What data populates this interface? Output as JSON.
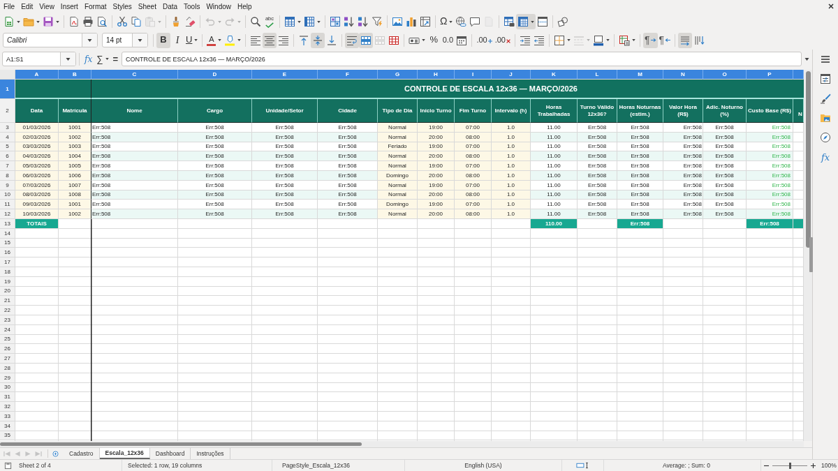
{
  "menu_bar": [
    "File",
    "Edit",
    "View",
    "Insert",
    "Format",
    "Styles",
    "Sheet",
    "Data",
    "Tools",
    "Window",
    "Help"
  ],
  "standard_toolbar": {
    "groups": [
      [
        {
          "kind": "new",
          "dropdown": true,
          "on": false,
          "disabled": false
        },
        {
          "kind": "open",
          "dropdown": true,
          "on": false,
          "disabled": false
        },
        {
          "kind": "save",
          "dropdown": true,
          "on": false,
          "disabled": false
        }
      ],
      [
        {
          "kind": "export-pdf",
          "dropdown": false,
          "on": false,
          "disabled": false
        },
        {
          "kind": "print",
          "dropdown": false,
          "on": false,
          "disabled": false
        },
        {
          "kind": "print-preview",
          "dropdown": false,
          "on": false,
          "disabled": false
        }
      ],
      [
        {
          "kind": "cut",
          "dropdown": false,
          "on": false,
          "disabled": false
        },
        {
          "kind": "copy",
          "dropdown": false,
          "on": false,
          "disabled": false
        },
        {
          "kind": "paste",
          "dropdown": true,
          "on": false,
          "disabled": true
        }
      ],
      [
        {
          "kind": "clone-formatting",
          "dropdown": false,
          "on": false,
          "disabled": false
        },
        {
          "kind": "clear-formatting",
          "dropdown": false,
          "on": false,
          "disabled": false
        }
      ],
      [
        {
          "kind": "undo",
          "dropdown": true,
          "on": false,
          "disabled": true
        },
        {
          "kind": "redo",
          "dropdown": true,
          "on": false,
          "disabled": true
        }
      ],
      [
        {
          "kind": "find-replace",
          "dropdown": false,
          "on": false,
          "disabled": false
        },
        {
          "kind": "spelling",
          "glyph": "abc",
          "dropdown": false,
          "on": false,
          "disabled": false
        }
      ],
      [
        {
          "kind": "rows",
          "dropdown": true,
          "on": false,
          "disabled": false
        },
        {
          "kind": "columns",
          "dropdown": true,
          "on": false,
          "disabled": false
        }
      ],
      [
        {
          "kind": "sort",
          "dropdown": false,
          "on": false,
          "disabled": false
        },
        {
          "kind": "sort-ascending",
          "dropdown": false,
          "on": false,
          "disabled": false
        },
        {
          "kind": "sort-descending",
          "dropdown": false,
          "on": false,
          "disabled": false
        },
        {
          "kind": "autofilter",
          "dropdown": false,
          "on": false,
          "disabled": false
        }
      ],
      [
        {
          "kind": "image",
          "dropdown": false,
          "on": false,
          "disabled": false
        },
        {
          "kind": "chart",
          "dropdown": false,
          "on": false,
          "disabled": false
        },
        {
          "kind": "pivot-table",
          "dropdown": false,
          "on": false,
          "disabled": false
        }
      ],
      [
        {
          "kind": "special-character",
          "glyph": "Ω",
          "dropdown": true,
          "on": false,
          "disabled": false
        },
        {
          "kind": "hyperlink",
          "dropdown": false,
          "on": false,
          "disabled": false
        },
        {
          "kind": "comment",
          "dropdown": false,
          "on": false,
          "disabled": false
        },
        {
          "kind": "header-footer",
          "dropdown": false,
          "on": false,
          "disabled": true
        }
      ],
      [
        {
          "kind": "print-area",
          "dropdown": false,
          "on": false,
          "disabled": false
        },
        {
          "kind": "freeze",
          "dropdown": true,
          "on": true,
          "disabled": false
        },
        {
          "kind": "split-window",
          "dropdown": false,
          "on": false,
          "disabled": false
        }
      ],
      [
        {
          "kind": "draw-functions",
          "dropdown": false,
          "on": false,
          "disabled": false
        }
      ]
    ]
  },
  "formatting_toolbar": {
    "font_name": "Calibri",
    "font_size": "14 pt",
    "groups": [
      [
        {
          "kind": "bold",
          "glyph": "B",
          "dropdown": false,
          "on": true,
          "disabled": false
        },
        {
          "kind": "italic",
          "glyph": "I",
          "dropdown": false,
          "on": false,
          "disabled": false
        },
        {
          "kind": "underline",
          "glyph": "U",
          "dropdown": true,
          "on": false,
          "disabled": false
        }
      ],
      [
        {
          "kind": "font-color",
          "glyph": "A",
          "dropdown": true,
          "on": false,
          "disabled": false
        },
        {
          "kind": "highlight",
          "dropdown": true,
          "on": false,
          "disabled": false
        }
      ],
      [
        {
          "kind": "align-left",
          "dropdown": false,
          "on": false,
          "disabled": false
        },
        {
          "kind": "align-center",
          "dropdown": false,
          "on": true,
          "disabled": false
        },
        {
          "kind": "align-right",
          "dropdown": false,
          "on": false,
          "disabled": false
        }
      ],
      [
        {
          "kind": "align-top",
          "dropdown": false,
          "on": false,
          "disabled": false
        },
        {
          "kind": "center-vertically",
          "dropdown": false,
          "on": true,
          "disabled": false
        },
        {
          "kind": "align-bottom",
          "dropdown": false,
          "on": false,
          "disabled": false
        }
      ],
      [
        {
          "kind": "wrap",
          "dropdown": false,
          "on": true,
          "disabled": false
        },
        {
          "kind": "merge-center",
          "dropdown": false,
          "on": true,
          "disabled": false
        },
        {
          "kind": "merge",
          "dropdown": false,
          "on": false,
          "disabled": true
        },
        {
          "kind": "unmerge",
          "dropdown": false,
          "on": false,
          "disabled": false
        }
      ],
      [
        {
          "kind": "number-format",
          "dropdown": true,
          "on": false,
          "disabled": false
        },
        {
          "kind": "percent",
          "glyph": "%",
          "dropdown": false,
          "on": false,
          "disabled": false
        },
        {
          "kind": "standard",
          "glyph": "0.0",
          "dropdown": false,
          "on": false,
          "disabled": false
        },
        {
          "kind": "date",
          "dropdown": false,
          "on": false,
          "disabled": false
        }
      ],
      [
        {
          "kind": "add-decimal",
          "glyph": ".00",
          "dropdown": false,
          "on": false,
          "disabled": false
        },
        {
          "kind": "delete-decimal",
          "glyph": ".00",
          "dropdown": false,
          "on": false,
          "disabled": false
        }
      ],
      [
        {
          "kind": "increase-indent",
          "dropdown": false,
          "on": false,
          "disabled": false
        },
        {
          "kind": "decrease-indent",
          "dropdown": false,
          "on": false,
          "disabled": false
        }
      ],
      [
        {
          "kind": "borders",
          "dropdown": true,
          "on": false,
          "disabled": false
        },
        {
          "kind": "border-style",
          "dropdown": true,
          "on": false,
          "disabled": true
        },
        {
          "kind": "border-color",
          "dropdown": true,
          "on": false,
          "disabled": false
        }
      ],
      [
        {
          "kind": "conditional",
          "dropdown": true,
          "on": false,
          "disabled": false
        }
      ],
      [
        {
          "kind": "left-to-right",
          "glyph": "¶",
          "dropdown": false,
          "on": true,
          "disabled": false
        },
        {
          "kind": "right-to-left",
          "glyph": "¶",
          "dropdown": false,
          "on": false,
          "disabled": false
        }
      ],
      [
        {
          "kind": "text-horizontal",
          "dropdown": false,
          "on": true,
          "disabled": false
        },
        {
          "kind": "text-vertical",
          "dropdown": false,
          "on": false,
          "disabled": false
        }
      ]
    ]
  },
  "formula_bar": {
    "name_box": "A1:S1",
    "function_wizard": "fx",
    "sum": "∑",
    "equals": "=",
    "content": "CONTROLE DE ESCALA 12x36 — MARÇO/2026"
  },
  "sidebar": {
    "functions": "fx"
  },
  "sheet": {
    "title": "CONTROLE DE ESCALA 12x36 — MARÇO/2026",
    "columns": [
      {
        "letter": "A",
        "selected": true,
        "header": "Data",
        "kind": "input",
        "total": "TOTAIS"
      },
      {
        "letter": "B",
        "selected": true,
        "header": "Matrícula",
        "kind": "input"
      },
      {
        "letter": "C",
        "selected": true,
        "header": "Nome",
        "kind": "text"
      },
      {
        "letter": "D",
        "selected": true,
        "header": "Cargo",
        "kind": "calc"
      },
      {
        "letter": "E",
        "selected": true,
        "header": "Unidade/Setor",
        "kind": "calc"
      },
      {
        "letter": "F",
        "selected": true,
        "header": "Cidade",
        "kind": "calc"
      },
      {
        "letter": "G",
        "selected": true,
        "header": "Tipo de Dia",
        "kind": "input"
      },
      {
        "letter": "H",
        "selected": true,
        "header": "Início Turno",
        "kind": "input"
      },
      {
        "letter": "I",
        "selected": true,
        "header": "Fim Turno",
        "kind": "input"
      },
      {
        "letter": "J",
        "selected": true,
        "header": "Intervalo (h)",
        "kind": "input"
      },
      {
        "letter": "K",
        "selected": true,
        "header": "Horas Trabalhadas",
        "kind": "calc",
        "total": "110.00"
      },
      {
        "letter": "L",
        "selected": true,
        "header": "Turno Válido 12x36?",
        "kind": "calc"
      },
      {
        "letter": "M",
        "selected": true,
        "header": "Horas Noturnas (estim.)",
        "kind": "calc",
        "total": "Err:508"
      },
      {
        "letter": "N",
        "selected": true,
        "header": "Valor Hora (R$)",
        "kind": "amount"
      },
      {
        "letter": "O",
        "selected": true,
        "header": "Adic. Noturno (%)",
        "kind": "calc"
      },
      {
        "letter": "P",
        "selected": true,
        "header": "Custo Base (R$)",
        "kind": "result",
        "total": "Err:508"
      }
    ],
    "cut_column": {
      "selected": true,
      "header": "N",
      "total_filled": true
    },
    "rows": [
      [
        "01/03/2026",
        "1001",
        "Err:508",
        "Err:508",
        "Err:508",
        "Err:508",
        "Normal",
        "19:00",
        "07:00",
        "1.0",
        "11.00",
        "Err:508",
        "Err:508",
        "Err:508",
        "Err:508",
        "Err:508"
      ],
      [
        "02/03/2026",
        "1002",
        "Err:508",
        "Err:508",
        "Err:508",
        "Err:508",
        "Normal",
        "20:00",
        "08:00",
        "1.0",
        "11.00",
        "Err:508",
        "Err:508",
        "Err:508",
        "Err:508",
        "Err:508"
      ],
      [
        "03/03/2026",
        "1003",
        "Err:508",
        "Err:508",
        "Err:508",
        "Err:508",
        "Feriado",
        "19:00",
        "07:00",
        "1.0",
        "11.00",
        "Err:508",
        "Err:508",
        "Err:508",
        "Err:508",
        "Err:508"
      ],
      [
        "04/03/2026",
        "1004",
        "Err:508",
        "Err:508",
        "Err:508",
        "Err:508",
        "Normal",
        "20:00",
        "08:00",
        "1.0",
        "11.00",
        "Err:508",
        "Err:508",
        "Err:508",
        "Err:508",
        "Err:508"
      ],
      [
        "05/03/2026",
        "1005",
        "Err:508",
        "Err:508",
        "Err:508",
        "Err:508",
        "Normal",
        "19:00",
        "07:00",
        "1.0",
        "11.00",
        "Err:508",
        "Err:508",
        "Err:508",
        "Err:508",
        "Err:508"
      ],
      [
        "06/03/2026",
        "1006",
        "Err:508",
        "Err:508",
        "Err:508",
        "Err:508",
        "Domingo",
        "20:00",
        "08:00",
        "1.0",
        "11.00",
        "Err:508",
        "Err:508",
        "Err:508",
        "Err:508",
        "Err:508"
      ],
      [
        "07/03/2026",
        "1007",
        "Err:508",
        "Err:508",
        "Err:508",
        "Err:508",
        "Normal",
        "19:00",
        "07:00",
        "1.0",
        "11.00",
        "Err:508",
        "Err:508",
        "Err:508",
        "Err:508",
        "Err:508"
      ],
      [
        "08/03/2026",
        "1008",
        "Err:508",
        "Err:508",
        "Err:508",
        "Err:508",
        "Normal",
        "20:00",
        "08:00",
        "1.0",
        "11.00",
        "Err:508",
        "Err:508",
        "Err:508",
        "Err:508",
        "Err:508"
      ],
      [
        "09/03/2026",
        "1001",
        "Err:508",
        "Err:508",
        "Err:508",
        "Err:508",
        "Domingo",
        "19:00",
        "07:00",
        "1.0",
        "11.00",
        "Err:508",
        "Err:508",
        "Err:508",
        "Err:508",
        "Err:508"
      ],
      [
        "10/03/2026",
        "1002",
        "Err:508",
        "Err:508",
        "Err:508",
        "Err:508",
        "Normal",
        "20:00",
        "08:00",
        "1.0",
        "11.00",
        "Err:508",
        "Err:508",
        "Err:508",
        "Err:508",
        "Err:508"
      ]
    ],
    "row_numbers": [
      {
        "label": "1",
        "selected": true
      },
      {
        "label": "2",
        "selected": false
      },
      {
        "label": "3",
        "selected": false
      },
      {
        "label": "4",
        "selected": false
      },
      {
        "label": "5",
        "selected": false
      },
      {
        "label": "6",
        "selected": false
      },
      {
        "label": "7",
        "selected": false
      },
      {
        "label": "8",
        "selected": false
      },
      {
        "label": "9",
        "selected": false
      },
      {
        "label": "10",
        "selected": false
      },
      {
        "label": "11",
        "selected": false
      },
      {
        "label": "12",
        "selected": false
      },
      {
        "label": "13",
        "selected": false
      },
      {
        "label": "14",
        "selected": false
      },
      {
        "label": "15",
        "selected": false
      },
      {
        "label": "16",
        "selected": false
      },
      {
        "label": "17",
        "selected": false
      },
      {
        "label": "18",
        "selected": false
      },
      {
        "label": "19",
        "selected": false
      },
      {
        "label": "20",
        "selected": false
      },
      {
        "label": "21",
        "selected": false
      },
      {
        "label": "22",
        "selected": false
      },
      {
        "label": "23",
        "selected": false
      },
      {
        "label": "24",
        "selected": false
      },
      {
        "label": "25",
        "selected": false
      },
      {
        "label": "26",
        "selected": false
      },
      {
        "label": "27",
        "selected": false
      },
      {
        "label": "28",
        "selected": false
      },
      {
        "label": "29",
        "selected": false
      },
      {
        "label": "30",
        "selected": false
      },
      {
        "label": "31",
        "selected": false
      },
      {
        "label": "32",
        "selected": false
      },
      {
        "label": "33",
        "selected": false
      },
      {
        "label": "34",
        "selected": false
      },
      {
        "label": "35",
        "selected": false
      }
    ]
  },
  "sheet_tabs": {
    "navigation_disabled": true,
    "tabs": [
      {
        "label": "Cadastro",
        "selected": false
      },
      {
        "label": "Escala_12x36",
        "selected": true
      },
      {
        "label": "Dashboard",
        "selected": false
      },
      {
        "label": "Instruções",
        "selected": false
      }
    ]
  },
  "status_bar": {
    "sheet": "Sheet 2 of 4",
    "selection": "Selected: 1 row, 19 columns",
    "page_style": "PageStyle_Escala_12x36",
    "language": "English (USA)",
    "summary": "Average: ; Sum: 0",
    "zoom_slider": {
      "level": 0.5
    },
    "zoom": "100%"
  }
}
